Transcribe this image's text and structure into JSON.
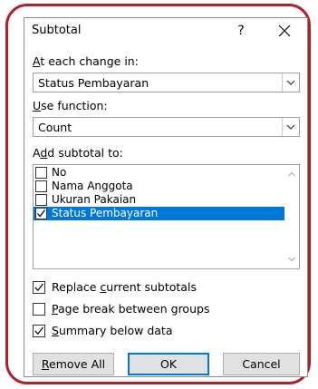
{
  "dialog": {
    "title": "Subtotal",
    "help_label": "?",
    "at_each_change": {
      "label_accel": "A",
      "label_rest": "t each change in:",
      "value": "Status Pembayaran"
    },
    "use_function": {
      "label_accel": "U",
      "label_rest": "se function:",
      "value": "Count"
    },
    "add_subtotal": {
      "label_pre": "A",
      "label_accel": "d",
      "label_rest": "d subtotal to:",
      "items": [
        {
          "label": "No",
          "checked": false,
          "selected": false
        },
        {
          "label": "Nama Anggota",
          "checked": false,
          "selected": false
        },
        {
          "label": "Ukuran Pakaian",
          "checked": false,
          "selected": false
        },
        {
          "label": "Status Pembayaran",
          "checked": true,
          "selected": true
        }
      ]
    },
    "options": {
      "replace": {
        "pre": "Replace ",
        "accel": "c",
        "rest": "urrent subtotals",
        "checked": true
      },
      "page_break": {
        "pre": "",
        "accel": "P",
        "rest": "age break between groups",
        "checked": false
      },
      "summary": {
        "pre": "",
        "accel": "S",
        "rest": "ummary below data",
        "checked": true
      }
    },
    "buttons": {
      "remove_all": {
        "accel": "R",
        "rest": "emove All"
      },
      "ok": "OK",
      "cancel": "Cancel"
    },
    "colors": {
      "highlight": "#0078d7",
      "annotation_frame": "#b1202c"
    }
  }
}
